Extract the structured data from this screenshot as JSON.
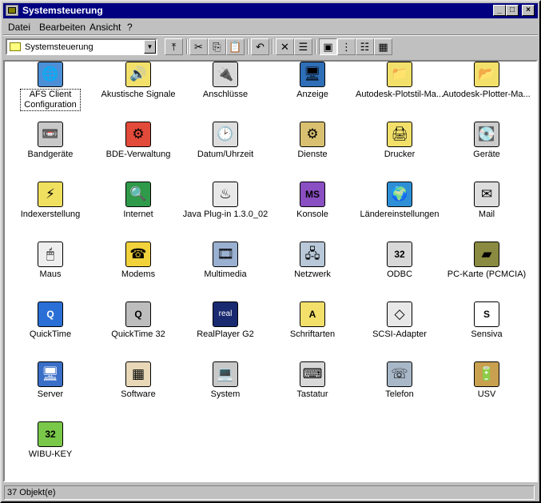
{
  "window": {
    "title": "Systemsteuerung"
  },
  "title_buttons": {
    "minimize": "_",
    "maximize": "□",
    "close": "×"
  },
  "menu": [
    {
      "label": "Datei"
    },
    {
      "label": "Bearbeiten"
    },
    {
      "label": "Ansicht"
    },
    {
      "label": "?"
    }
  ],
  "address": {
    "value": "Systemsteuerung"
  },
  "toolbar_glyphs": {
    "up": "⤒",
    "cut": "✂",
    "copy": "⎘",
    "paste": "📋",
    "undo": "↶",
    "delete": "✕",
    "properties": "☰",
    "large_icons": "▣",
    "small_icons": "⋮",
    "list": "☷",
    "details": "▦"
  },
  "items": [
    {
      "label": "AFS Client Configuration",
      "icon": "globe-computer-icon",
      "glyph": "🌐",
      "color": "#4c8fd6"
    },
    {
      "label": "Akustische Signale",
      "icon": "speaker-computer-icon",
      "glyph": "🔊",
      "color": "#f2e06b"
    },
    {
      "label": "Anschlüsse",
      "icon": "cable-plug-icon",
      "glyph": "🔌",
      "color": "#d8d8d8"
    },
    {
      "label": "Anzeige",
      "icon": "display-monitor-icon",
      "glyph": "🖥",
      "color": "#2f6fb8"
    },
    {
      "label": "Autodesk-Plotstil-Ma...",
      "icon": "plot-folder-icon",
      "glyph": "📁",
      "color": "#f2e06b"
    },
    {
      "label": "Autodesk-Plotter-Ma...",
      "icon": "plotter-folder-icon",
      "glyph": "📂",
      "color": "#f2e06b"
    },
    {
      "label": "Bandgeräte",
      "icon": "tape-drive-icon",
      "glyph": "📼",
      "color": "#c8c8c8"
    },
    {
      "label": "BDE-Verwaltung",
      "icon": "database-admin-icon",
      "glyph": "⚙",
      "color": "#e24a3a"
    },
    {
      "label": "Datum/Uhrzeit",
      "icon": "calendar-clock-icon",
      "glyph": "🕑",
      "color": "#dddddd"
    },
    {
      "label": "Dienste",
      "icon": "gears-icon",
      "glyph": "⚙",
      "color": "#d8c070"
    },
    {
      "label": "Drucker",
      "icon": "printer-folder-icon",
      "glyph": "🖨",
      "color": "#f2e06b"
    },
    {
      "label": "Geräte",
      "icon": "devices-icon",
      "glyph": "💽",
      "color": "#cccccc"
    },
    {
      "label": "Indexerstellung",
      "icon": "binoculars-icon",
      "glyph": "⚡",
      "color": "#f0e060"
    },
    {
      "label": "Internet",
      "icon": "internet-globe-icon",
      "glyph": "🔍",
      "color": "#2f9a4a"
    },
    {
      "label": "Java Plug-in 1.3.0_02",
      "icon": "java-duke-icon",
      "glyph": "♨",
      "color": "#e8e8e8"
    },
    {
      "label": "Konsole",
      "icon": "msdos-console-icon",
      "glyph": "MS",
      "color": "#8a4fc2"
    },
    {
      "label": "Ländereinstellungen",
      "icon": "world-globe-icon",
      "glyph": "🌍",
      "color": "#2f8fd6"
    },
    {
      "label": "Mail",
      "icon": "mail-postbox-icon",
      "glyph": "✉",
      "color": "#dddddd"
    },
    {
      "label": "Maus",
      "icon": "mouse-icon",
      "glyph": "🖱",
      "color": "#eeeeee"
    },
    {
      "label": "Modems",
      "icon": "modem-phone-icon",
      "glyph": "☎",
      "color": "#f2d23b"
    },
    {
      "label": "Multimedia",
      "icon": "multimedia-icon",
      "glyph": "🎞",
      "color": "#9ab0d0"
    },
    {
      "label": "Netzwerk",
      "icon": "network-computers-icon",
      "glyph": "🖧",
      "color": "#b8c8d8"
    },
    {
      "label": "ODBC",
      "icon": "odbc-database-icon",
      "glyph": "32",
      "color": "#d8d8d8"
    },
    {
      "label": "PC-Karte (PCMCIA)",
      "icon": "pc-card-icon",
      "glyph": "▰",
      "color": "#8a8a40"
    },
    {
      "label": "QuickTime",
      "icon": "quicktime-icon",
      "glyph": "Q",
      "color": "#2a6fd6"
    },
    {
      "label": "QuickTime 32",
      "icon": "quicktime32-icon",
      "glyph": "Q",
      "color": "#bdbdbd"
    },
    {
      "label": "RealPlayer G2",
      "icon": "realplayer-icon",
      "glyph": "real",
      "color": "#1a2a70"
    },
    {
      "label": "Schriftarten",
      "icon": "fonts-folder-icon",
      "glyph": "A",
      "color": "#f2e06b"
    },
    {
      "label": "SCSI-Adapter",
      "icon": "scsi-adapter-icon",
      "glyph": "◇",
      "color": "#e8e8e8"
    },
    {
      "label": "Sensiva",
      "icon": "sensiva-document-icon",
      "glyph": "S",
      "color": "#ffffff"
    },
    {
      "label": "Server",
      "icon": "server-hand-icon",
      "glyph": "🖥",
      "color": "#3a6fc8"
    },
    {
      "label": "Software",
      "icon": "software-install-icon",
      "glyph": "▦",
      "color": "#e8d8b8"
    },
    {
      "label": "System",
      "icon": "system-computer-icon",
      "glyph": "💻",
      "color": "#c8c8c8"
    },
    {
      "label": "Tastatur",
      "icon": "keyboard-icon",
      "glyph": "⌨",
      "color": "#d8d8d8"
    },
    {
      "label": "Telefon",
      "icon": "telephone-network-icon",
      "glyph": "☏",
      "color": "#a8b8c8"
    },
    {
      "label": "USV",
      "icon": "ups-power-icon",
      "glyph": "🔋",
      "color": "#c8a050"
    },
    {
      "label": "WIBU-KEY",
      "icon": "wibu-key-icon",
      "glyph": "32",
      "color": "#7ac84a"
    }
  ],
  "statusbar": {
    "text": "37 Objekt(e)"
  }
}
